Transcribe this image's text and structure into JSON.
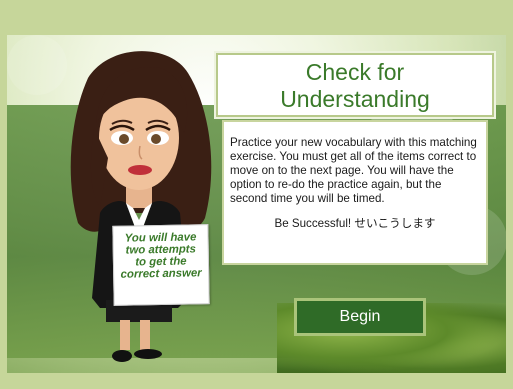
{
  "title": {
    "line1": "Check for",
    "line2": "Understanding"
  },
  "instructions": "Practice your new vocabulary with this matching exercise. You must get all of the items correct to move on to the next page. You will have the option to re-do the practice again, but the second time you will be timed.",
  "success_text": "Be Successful! せいこうします",
  "sign": {
    "l1": "You will have",
    "l2": "two attempts",
    "l3": "to get the",
    "l4": "correct answer"
  },
  "begin_label": "Begin",
  "colors": {
    "accent_green": "#3a7a2a",
    "button_green": "#2f6b27",
    "frame": "#c6d69a"
  }
}
